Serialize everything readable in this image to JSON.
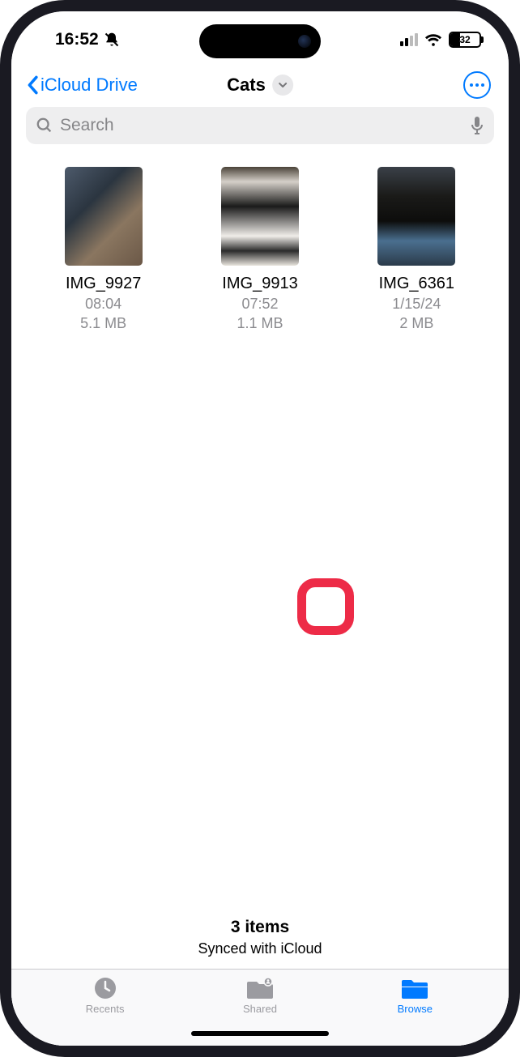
{
  "status": {
    "time": "16:52",
    "battery": "32"
  },
  "nav": {
    "back_label": "iCloud Drive",
    "title": "Cats"
  },
  "search": {
    "placeholder": "Search"
  },
  "files": [
    {
      "name": "IMG_9927",
      "time": "08:04",
      "size": "5.1 MB"
    },
    {
      "name": "IMG_9913",
      "time": "07:52",
      "size": "1.1 MB"
    },
    {
      "name": "IMG_6361",
      "time": "1/15/24",
      "size": "2 MB"
    }
  ],
  "footer": {
    "count": "3 items",
    "sync": "Synced with iCloud"
  },
  "tabs": {
    "recents": "Recents",
    "shared": "Shared",
    "browse": "Browse"
  }
}
